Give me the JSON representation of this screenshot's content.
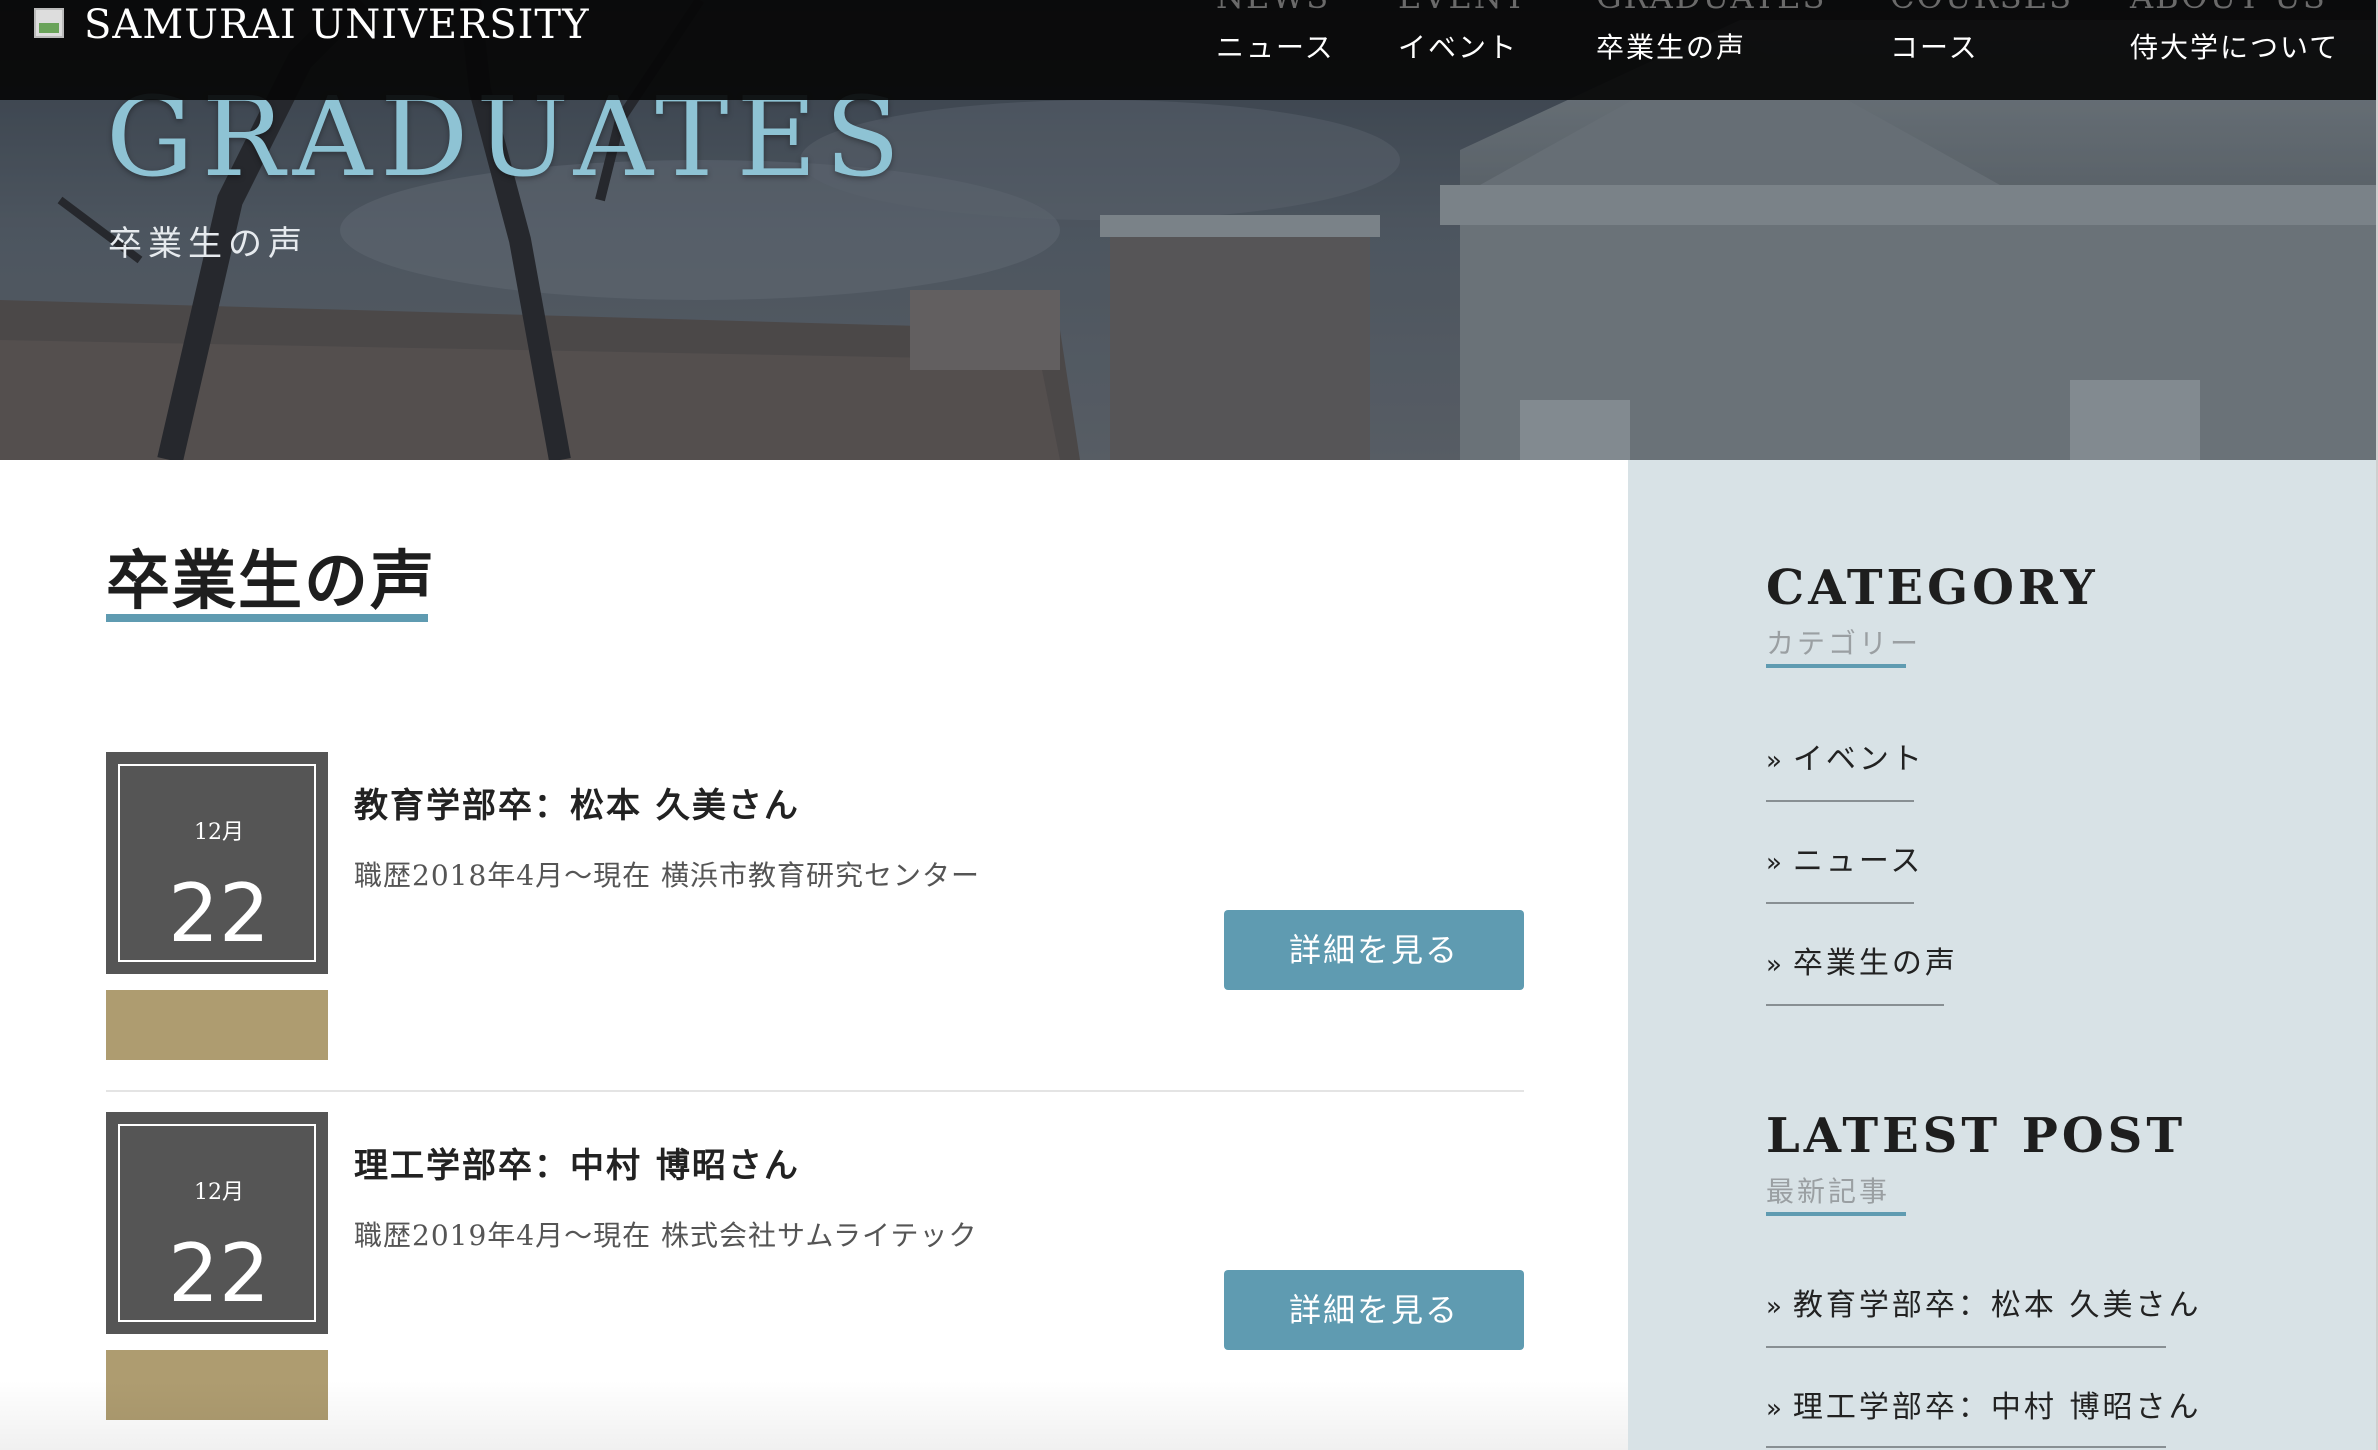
{
  "header": {
    "logo_text": "SAMURAI UNIVERSITY",
    "nav": [
      {
        "en": "NEWS",
        "jp": "ニュース"
      },
      {
        "en": "EVENT",
        "jp": "イベント"
      },
      {
        "en": "GRADUATES",
        "jp": "卒業生の声"
      },
      {
        "en": "COURSES",
        "jp": "コース"
      },
      {
        "en": "ABOUT US",
        "jp": "侍大学について"
      }
    ]
  },
  "hero": {
    "title": "GRADUATES",
    "subtitle": "卒業生の声"
  },
  "main": {
    "section_title": "卒業生の声",
    "posts": [
      {
        "month": "12月",
        "day": "22",
        "title": "教育学部卒：松本 久美さん",
        "career": "職歴2018年4月〜現在 横浜市教育研究センター",
        "button": "詳細を見る"
      },
      {
        "month": "12月",
        "day": "22",
        "title": "理工学部卒：中村 博昭さん",
        "career": "職歴2019年4月〜現在 株式会社サムライテック",
        "button": "詳細を見る"
      }
    ]
  },
  "sidebar": {
    "category": {
      "heading": "CATEGORY",
      "sub": "カテゴリー",
      "items": [
        "イベント",
        "ニュース",
        "卒業生の声"
      ]
    },
    "latest": {
      "heading": "LATEST POST",
      "sub": "最新記事",
      "items": [
        "教育学部卒：松本 久美さん",
        "理工学部卒：中村 博昭さん"
      ]
    }
  },
  "colors": {
    "accent": "#5f9bb1",
    "hero_title": "#8ec3d4",
    "date_box": "#555555",
    "category_box": "#ae9c70",
    "sidebar_bg": "#d8e2e6",
    "header_bg": "#080808"
  },
  "icons": {
    "logo": "broken-image-icon",
    "list_marker": "double-chevron-right-icon"
  }
}
